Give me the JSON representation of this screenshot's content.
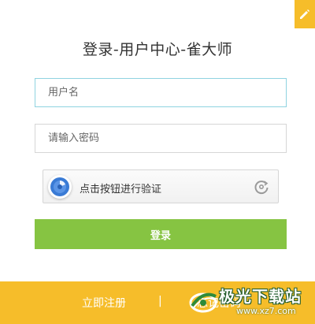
{
  "title": "登录-用户中心-雀大师",
  "username": {
    "placeholder": "用户名"
  },
  "password": {
    "placeholder": "请输入密码"
  },
  "captcha": {
    "label": "点击按钮进行验证"
  },
  "login_button": "登录",
  "footer": {
    "register": "立即注册",
    "divider": "|",
    "forgot": "忘记密码"
  },
  "watermark": {
    "name": "极光下载站",
    "url": "www.xz7.com"
  },
  "colors": {
    "accent_yellow": "#f6bd2a",
    "login_green": "#86c442",
    "captcha_blue": "#3a7bd5",
    "focus_border": "#8fd3e0"
  },
  "icons": {
    "edit": "pencil-icon",
    "captcha_knob": "captcha-target-icon",
    "refresh": "refresh-icon"
  }
}
